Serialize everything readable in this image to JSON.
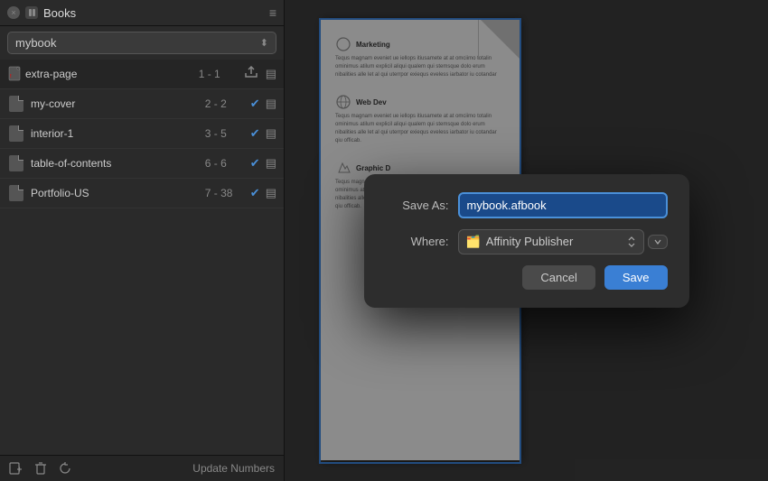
{
  "panel": {
    "close_btn": "×",
    "title": "Books",
    "menu_icon": "≡",
    "book_name": "mybook",
    "items": [
      {
        "name": "extra-page",
        "pages": "1 - 1",
        "has_check": false,
        "is_extra": true
      },
      {
        "name": "my-cover",
        "pages": "2 - 2",
        "has_check": true
      },
      {
        "name": "interior-1",
        "pages": "3 - 5",
        "has_check": true
      },
      {
        "name": "table-of-contents",
        "pages": "6 - 6",
        "has_check": true
      },
      {
        "name": "Portfolio-US",
        "pages": "7 - 38",
        "has_check": true
      }
    ],
    "footer": {
      "update_btn": "Update Numbers"
    }
  },
  "page_content": {
    "marketing_title": "Marketing",
    "marketing_text": "Tequs magnam eveniet ue iellops itiusamete at at omciimo totalin ominimus atilum explicil aliqui qualem qui stemsque dolo erum nibalities alle let al qui uterrpor exiequs eveless iarbator iu cotandar",
    "web_dev_title": "Web Dev",
    "web_dev_text": "Tequs magnam eveniet ue iellops itiusamete at at omciimo totalin ominimus atilum explicil aliqui qualem qui stemsque dolo erum nibalities alle let al qui uterrpor exiequs eveless iarbator iu cotandar qiu officab.",
    "graphic_title": "Graphic D",
    "graphic_text": "Tequs magnam eveniet ue iellops itiusamete at at omciimo totalin ominimus atilum explicil aliqui qualem qui stemsque dolo erum nibalities alle let al qui uterrpor exiequs eveless iarbator iu cotandar qiu officab."
  },
  "dialog": {
    "save_as_label": "Save As:",
    "filename": "mybook.afbook",
    "where_label": "Where:",
    "location_icon": "📁",
    "location": "Affinity Publisher",
    "cancel_label": "Cancel",
    "save_label": "Save"
  }
}
